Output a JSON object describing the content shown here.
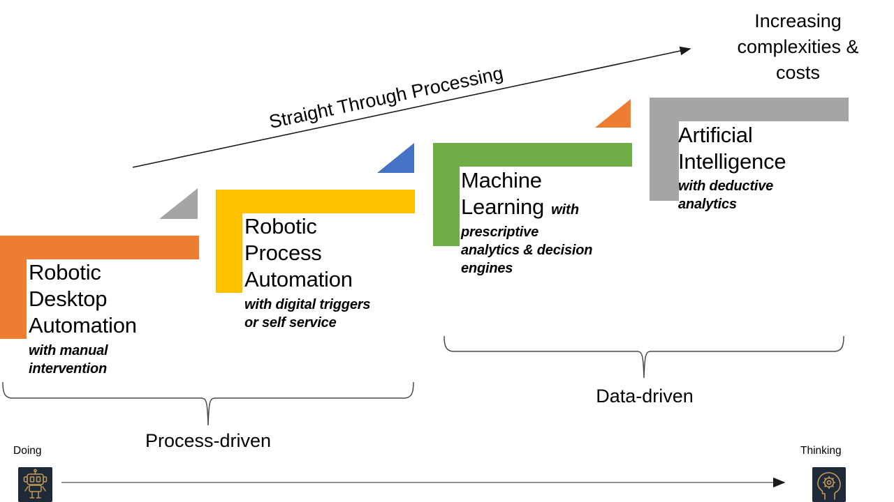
{
  "diagram": {
    "top_arrow_label": "Straight Through Processing",
    "top_right_label_line1": "Increasing",
    "top_right_label_line2": "complexities &",
    "top_right_label_line3": "costs",
    "bottom_left_corner_label": "Doing",
    "bottom_right_corner_label": "Thinking",
    "brace_left_label": "Process-driven",
    "brace_right_label": "Data-driven",
    "left_icon_name": "robot-icon",
    "right_icon_name": "brain-head-gear-icon"
  },
  "stages": [
    {
      "id": "robotic-desktop-automation",
      "title_lines": [
        "Robotic",
        "Desktop",
        "Automation"
      ],
      "subtitle_lines": [
        "with manual",
        "intervention"
      ],
      "subtitle_inline": "",
      "color": "#ED7D31",
      "marker_triangle_color": "#A5A5A5"
    },
    {
      "id": "robotic-process-automation",
      "title_lines": [
        "Robotic",
        "Process",
        "Automation"
      ],
      "subtitle_lines": [
        "with digital triggers",
        "or self service"
      ],
      "subtitle_inline": "",
      "color": "#FFC000",
      "marker_triangle_color": "#4472C4"
    },
    {
      "id": "machine-learning",
      "title_lines": [
        "Machine",
        "Learning"
      ],
      "subtitle_lines": [
        "prescriptive",
        "analytics & decision",
        "engines"
      ],
      "subtitle_inline": "with",
      "color": "#70AD47",
      "marker_triangle_color": "#ED7D31"
    },
    {
      "id": "artificial-intelligence",
      "title_lines": [
        "Artificial",
        "Intelligence"
      ],
      "subtitle_lines": [
        "with deductive",
        "analytics"
      ],
      "subtitle_inline": "",
      "color": "#A5A5A5",
      "marker_triangle_color": ""
    }
  ],
  "colors": {
    "orange": "#ED7D31",
    "yellow": "#FFC000",
    "green": "#70AD47",
    "gray": "#A5A5A5",
    "blue": "#4472C4",
    "line": "#3a3a3a",
    "icon_bg": "#1f2a38",
    "icon_fg": "#c49a5a"
  }
}
